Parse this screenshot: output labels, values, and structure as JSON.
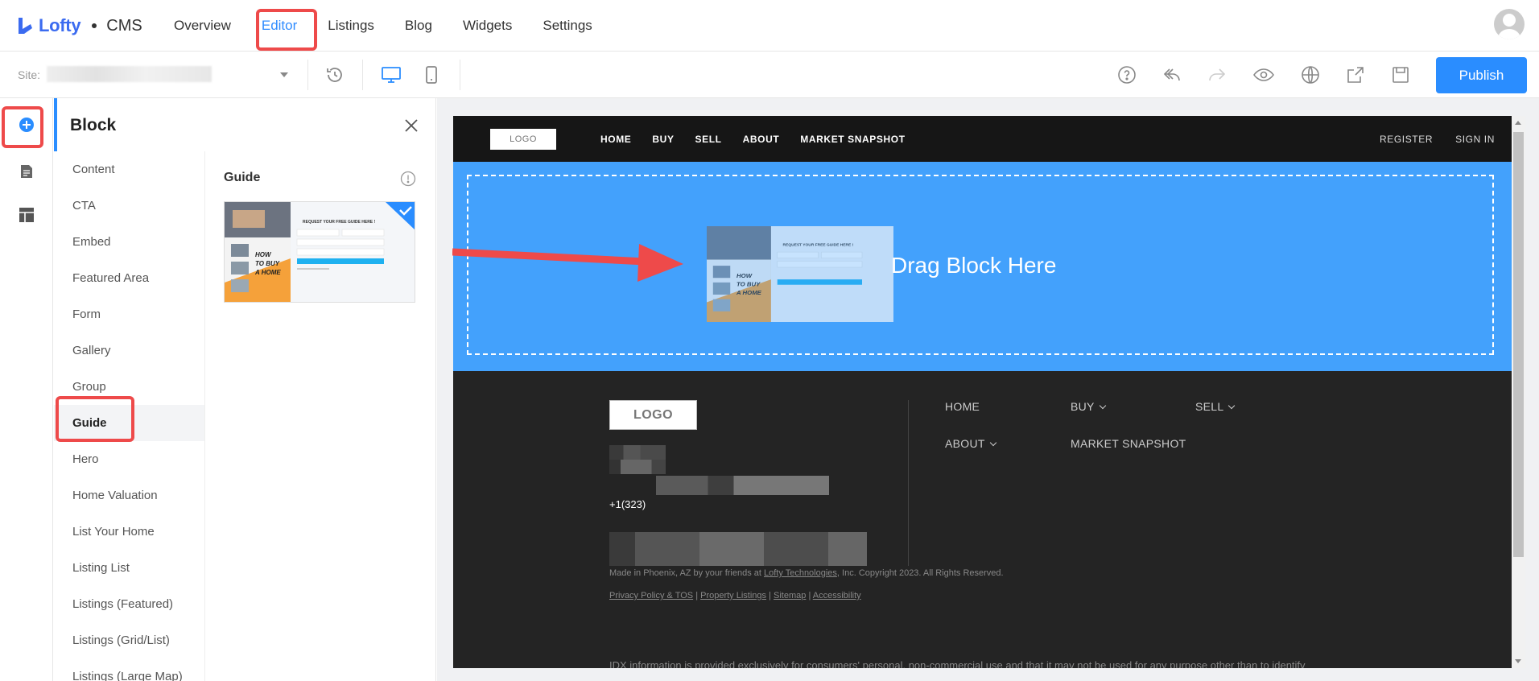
{
  "app": {
    "brand": "Lofty",
    "product": "CMS"
  },
  "nav": {
    "items": [
      {
        "label": "Overview"
      },
      {
        "label": "Editor",
        "active": true
      },
      {
        "label": "Listings"
      },
      {
        "label": "Blog"
      },
      {
        "label": "Widgets"
      },
      {
        "label": "Settings"
      }
    ]
  },
  "toolbar": {
    "site_label": "Site:",
    "publish_label": "Publish",
    "icons": [
      "history-icon",
      "desktop-icon",
      "mobile-icon",
      "help-icon",
      "undo-icon",
      "redo-icon",
      "preview-icon",
      "globe-icon",
      "share-icon",
      "save-icon"
    ]
  },
  "panel": {
    "title": "Block",
    "categories": [
      "Content",
      "CTA",
      "Embed",
      "Featured Area",
      "Form",
      "Gallery",
      "Group",
      "Guide",
      "Hero",
      "Home Valuation",
      "List Your Home",
      "Listing List",
      "Listings (Featured)",
      "Listings (Grid/List)",
      "Listings (Large Map)"
    ],
    "selected_category": "Guide",
    "section_title": "Guide",
    "thumbnail": {
      "heading": "REQUEST YOUR FREE GUIDE HERE !",
      "book_title": "HOW TO BUY A HOME"
    }
  },
  "preview": {
    "header": {
      "logo": "LOGO",
      "nav": [
        "HOME",
        "BUY",
        "SELL",
        "ABOUT",
        "MARKET SNAPSHOT"
      ],
      "right": [
        "REGISTER",
        "SIGN IN"
      ]
    },
    "drop_zone_text": "Drag Block Here",
    "footer": {
      "logo": "LOGO",
      "links": [
        {
          "label": "HOME",
          "dropdown": false
        },
        {
          "label": "BUY",
          "dropdown": true
        },
        {
          "label": "SELL",
          "dropdown": true
        },
        {
          "label": "ABOUT",
          "dropdown": true
        },
        {
          "label": "MARKET SNAPSHOT",
          "dropdown": false
        }
      ],
      "phone_prefix": "+1(323)",
      "made_in": "Made in Phoenix, AZ by your friends at",
      "company_link": "Lofty Technologies",
      "copyright": ", Inc. Copyright 2023. All Rights Reserved.",
      "legal_links": [
        "Privacy Policy & TOS",
        "Property Listings",
        "Sitemap",
        "Accessibility"
      ],
      "legal_sep": "|",
      "idx_text": "IDX information is provided exclusively for consumers' personal, non-commercial use and that it may not be used for any purpose other than to identify"
    }
  },
  "colors": {
    "accent": "#2a8dff",
    "highlight": "#ee4a4a",
    "drop_zone": "#43a1fc",
    "header_bg": "#161616",
    "footer_bg": "#242424"
  }
}
